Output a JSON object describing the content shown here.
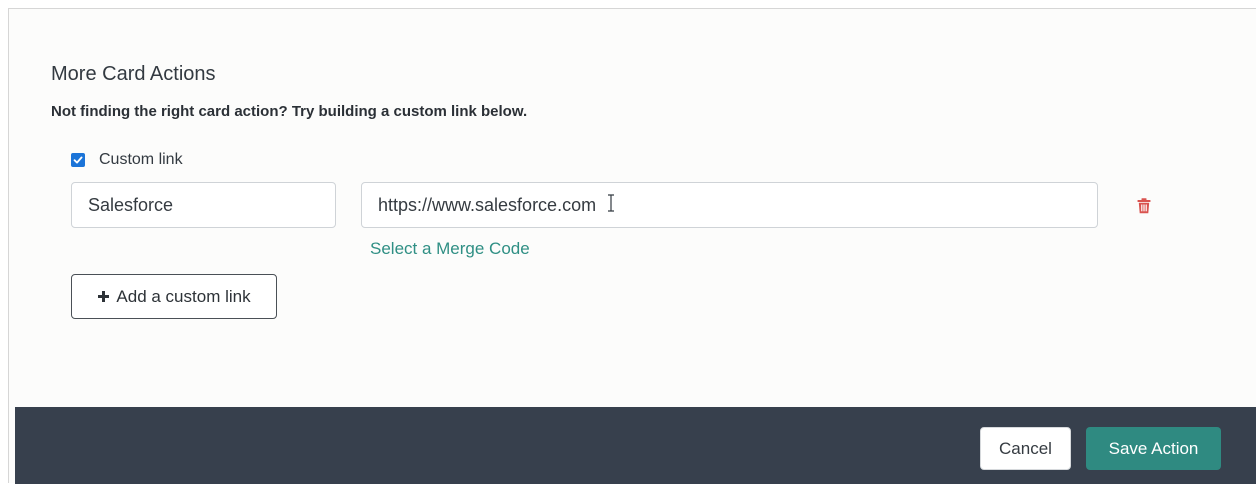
{
  "section": {
    "title": "More Card Actions",
    "subtitle": "Not finding the right card action? Try building a custom link below."
  },
  "custom_link": {
    "checkbox_label": "Custom link",
    "checked": true,
    "name_value": "Salesforce",
    "url_value": "https://www.salesforce.com",
    "merge_code_link": "Select a Merge Code"
  },
  "add_button_label": "Add a custom link",
  "footer": {
    "cancel_label": "Cancel",
    "save_label": "Save Action"
  },
  "icons": {
    "checkbox": "checkmark-icon",
    "add": "plus-icon",
    "delete": "trash-icon",
    "cursor": "text-cursor-icon"
  },
  "colors": {
    "accent": "#2f8a81",
    "link": "#2f8f84",
    "checkbox": "#1b74d8",
    "footer_bg": "#37404d",
    "delete_icon": "#d9534f"
  }
}
